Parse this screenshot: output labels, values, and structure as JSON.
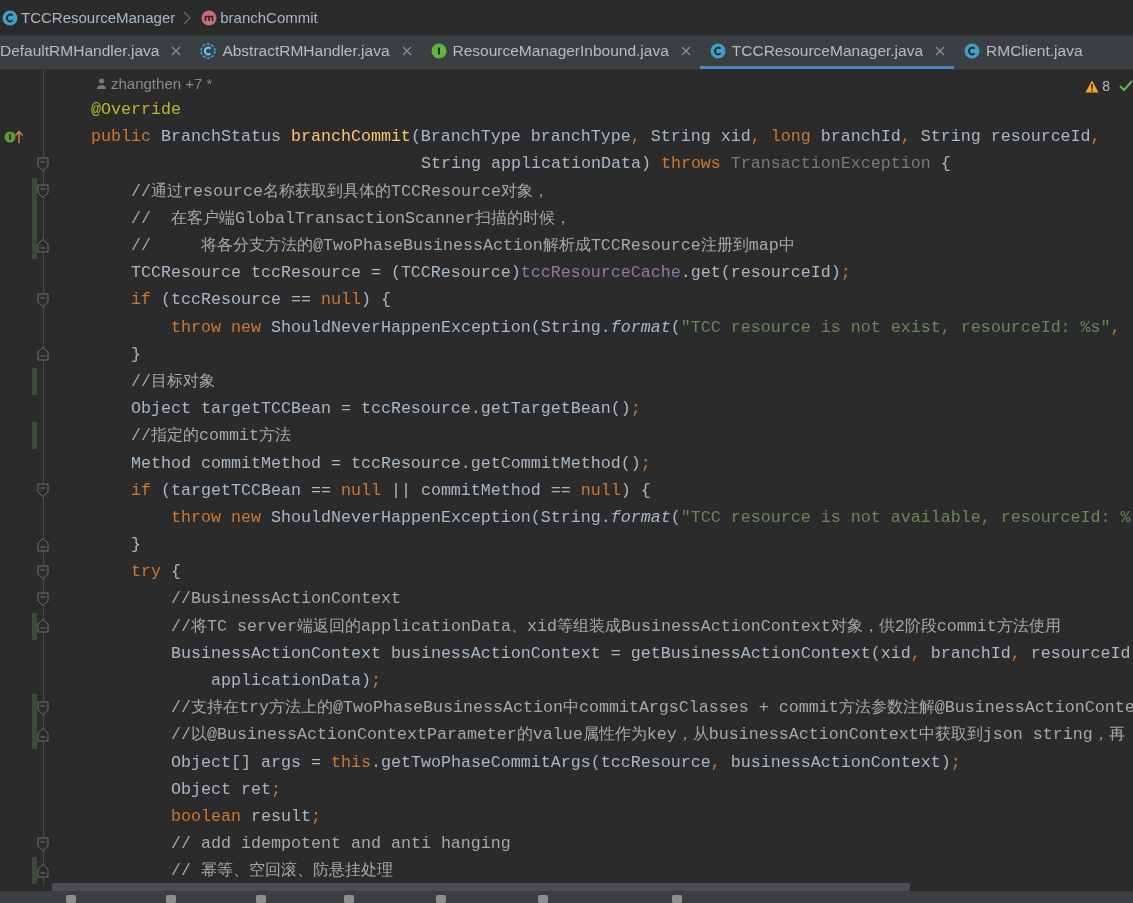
{
  "breadcrumb": [
    {
      "kind": "class",
      "text": "TCCResourceManager"
    },
    {
      "kind": "method",
      "text": "branchCommit"
    }
  ],
  "tabs": [
    {
      "label": "DefaultRMHandler.java",
      "kind": "plain",
      "selected": false
    },
    {
      "label": "AbstractRMHandler.java",
      "kind": "abstract",
      "selected": false
    },
    {
      "label": "ResourceManagerInbound.java",
      "kind": "interface",
      "selected": false
    },
    {
      "label": "TCCResourceManager.java",
      "kind": "class",
      "selected": true
    },
    {
      "label": "RMClient.java",
      "kind": "class",
      "selected": false
    }
  ],
  "editor": {
    "author_hint": "zhangthen +7 *",
    "warnings": "8",
    "lines": [
      {
        "kind": "code",
        "fold_start": false,
        "fold_end": false,
        "changed": false,
        "implemented": false,
        "tokens": [
          {
            "kind": "annotation",
            "text": "@Override"
          }
        ]
      },
      {
        "kind": "code",
        "fold_start": false,
        "fold_end": false,
        "changed": false,
        "implemented": true,
        "tokens": [
          {
            "kind": "keyword",
            "text": "public "
          },
          {
            "kind": "plain",
            "text": "BranchStatus "
          },
          {
            "kind": "declaration",
            "text": "branchCommit"
          },
          {
            "kind": "plain",
            "text": "(BranchType branchType"
          },
          {
            "kind": "keyword",
            "text": ", "
          },
          {
            "kind": "plain",
            "text": "String xid"
          },
          {
            "kind": "keyword",
            "text": ", long "
          },
          {
            "kind": "plain",
            "text": "branchId"
          },
          {
            "kind": "keyword",
            "text": ", "
          },
          {
            "kind": "plain",
            "text": "String resourceId"
          },
          {
            "kind": "keyword",
            "text": ","
          }
        ]
      },
      {
        "kind": "wrapped",
        "fold_start": true,
        "fold_end": false,
        "changed": false,
        "implemented": false,
        "tokens": [
          {
            "kind": "plain",
            "text": "String applicationData) "
          },
          {
            "kind": "keyword",
            "text": "throws "
          },
          {
            "kind": "unused",
            "text": "TransactionException"
          },
          {
            "kind": "plain",
            "text": " {"
          }
        ],
        "children": [
          {
            "kind": "code",
            "fold_start": true,
            "fold_end": false,
            "changed": true,
            "implemented": false,
            "tokens": [
              {
                "kind": "comment",
                "text": "//通过resource名称获取到具体的TCCResource对象，"
              }
            ]
          },
          {
            "kind": "code",
            "fold_start": false,
            "fold_end": false,
            "changed": true,
            "implemented": false,
            "tokens": [
              {
                "kind": "comment",
                "text": "//  在客户端GlobalTransactionScanner扫描的时候，"
              }
            ]
          },
          {
            "kind": "code",
            "fold_start": false,
            "fold_end": true,
            "changed": true,
            "implemented": false,
            "tokens": [
              {
                "kind": "comment",
                "text": "//     将各分支方法的@TwoPhaseBusinessAction解析成TCCResource注册到map中"
              }
            ]
          },
          {
            "kind": "code",
            "fold_start": false,
            "fold_end": false,
            "changed": false,
            "implemented": false,
            "tokens": [
              {
                "kind": "plain",
                "text": "TCCResource tccResource = (TCCResource)"
              },
              {
                "kind": "field",
                "text": "tccResourceCache"
              },
              {
                "kind": "plain",
                "text": ".get(resourceId)"
              },
              {
                "kind": "keyword",
                "text": ";"
              }
            ]
          },
          {
            "kind": "code",
            "fold_start": true,
            "fold_end": false,
            "changed": false,
            "implemented": false,
            "tokens": [
              {
                "kind": "keyword",
                "text": "if "
              },
              {
                "kind": "plain",
                "text": "(tccResource == "
              },
              {
                "kind": "keyword",
                "text": "null"
              },
              {
                "kind": "plain",
                "text": ") {"
              }
            ],
            "children": [
              {
                "kind": "code",
                "fold_start": false,
                "fold_end": false,
                "changed": false,
                "implemented": false,
                "tokens": [
                  {
                    "kind": "keyword",
                    "text": "throw new "
                  },
                  {
                    "kind": "plain",
                    "text": "ShouldNeverHappenException(String."
                  },
                  {
                    "kind": "static",
                    "text": "format"
                  },
                  {
                    "kind": "plain",
                    "text": "("
                  },
                  {
                    "kind": "string",
                    "text": "\"TCC resource is not exist, resourceId: %s\""
                  },
                  {
                    "kind": "keyword",
                    "text": ","
                  }
                ]
              }
            ]
          },
          {
            "kind": "code",
            "fold_start": false,
            "fold_end": true,
            "changed": false,
            "implemented": false,
            "tokens": [
              {
                "kind": "plain",
                "text": "}"
              }
            ]
          },
          {
            "kind": "code",
            "fold_start": false,
            "fold_end": false,
            "changed": true,
            "implemented": false,
            "tokens": [
              {
                "kind": "comment",
                "text": "//目标对象"
              }
            ]
          },
          {
            "kind": "code",
            "fold_start": false,
            "fold_end": false,
            "changed": false,
            "implemented": false,
            "tokens": [
              {
                "kind": "plain",
                "text": "Object targetTCCBean = tccResource.getTargetBean()"
              },
              {
                "kind": "keyword",
                "text": ";"
              }
            ]
          },
          {
            "kind": "code",
            "fold_start": false,
            "fold_end": false,
            "changed": true,
            "implemented": false,
            "tokens": [
              {
                "kind": "comment",
                "text": "//指定的commit方法"
              }
            ]
          },
          {
            "kind": "code",
            "fold_start": false,
            "fold_end": false,
            "changed": false,
            "implemented": false,
            "tokens": [
              {
                "kind": "plain",
                "text": "Method commitMethod = tccResource.getCommitMethod()"
              },
              {
                "kind": "keyword",
                "text": ";"
              }
            ]
          },
          {
            "kind": "code",
            "fold_start": true,
            "fold_end": false,
            "changed": false,
            "implemented": false,
            "tokens": [
              {
                "kind": "keyword",
                "text": "if "
              },
              {
                "kind": "plain",
                "text": "(targetTCCBean == "
              },
              {
                "kind": "keyword",
                "text": "null"
              },
              {
                "kind": "plain",
                "text": " || commitMethod == "
              },
              {
                "kind": "keyword",
                "text": "null"
              },
              {
                "kind": "plain",
                "text": ") {"
              }
            ],
            "children": [
              {
                "kind": "code",
                "fold_start": false,
                "fold_end": false,
                "changed": false,
                "implemented": false,
                "tokens": [
                  {
                    "kind": "keyword",
                    "text": "throw new "
                  },
                  {
                    "kind": "plain",
                    "text": "ShouldNeverHappenException(String."
                  },
                  {
                    "kind": "static",
                    "text": "format"
                  },
                  {
                    "kind": "plain",
                    "text": "("
                  },
                  {
                    "kind": "string",
                    "text": "\"TCC resource is not available, resourceId: %"
                  }
                ]
              }
            ]
          },
          {
            "kind": "code",
            "fold_start": false,
            "fold_end": true,
            "changed": false,
            "implemented": false,
            "tokens": [
              {
                "kind": "plain",
                "text": "}"
              }
            ]
          },
          {
            "kind": "code",
            "fold_start": true,
            "fold_end": false,
            "changed": false,
            "implemented": false,
            "tokens": [
              {
                "kind": "keyword",
                "text": "try "
              },
              {
                "kind": "plain",
                "text": "{"
              }
            ],
            "children": [
              {
                "kind": "code",
                "fold_start": true,
                "fold_end": false,
                "changed": false,
                "implemented": false,
                "tokens": [
                  {
                    "kind": "comment",
                    "text": "//BusinessActionContext"
                  }
                ]
              },
              {
                "kind": "code",
                "fold_start": false,
                "fold_end": true,
                "changed": true,
                "implemented": false,
                "tokens": [
                  {
                    "kind": "comment",
                    "text": "//将TC server端返回的applicationData、xid等组装成BusinessActionContext对象，供2阶段commit方法使用"
                  }
                ]
              },
              {
                "kind": "code",
                "fold_start": false,
                "fold_end": false,
                "changed": false,
                "implemented": false,
                "tokens": [
                  {
                    "kind": "plain",
                    "text": "BusinessActionContext businessActionContext = getBusinessActionContext(xid"
                  },
                  {
                    "kind": "keyword",
                    "text": ", "
                  },
                  {
                    "kind": "plain",
                    "text": "branchId"
                  },
                  {
                    "kind": "keyword",
                    "text": ", "
                  },
                  {
                    "kind": "plain",
                    "text": "resourceId"
                  }
                ],
                "children": [
                  {
                    "kind": "code",
                    "fold_start": false,
                    "fold_end": false,
                    "changed": false,
                    "implemented": false,
                    "tokens": [
                      {
                        "kind": "plain",
                        "text": "applicationData)"
                      },
                      {
                        "kind": "keyword",
                        "text": ";"
                      }
                    ]
                  }
                ]
              },
              {
                "kind": "code",
                "fold_start": true,
                "fold_end": false,
                "changed": true,
                "implemented": false,
                "tokens": [
                  {
                    "kind": "comment",
                    "text": "//支持在try方法上的@TwoPhaseBusinessAction中commitArgsClasses + commit方法参数注解@BusinessActionConte"
                  }
                ]
              },
              {
                "kind": "code",
                "fold_start": false,
                "fold_end": true,
                "changed": true,
                "implemented": false,
                "tokens": [
                  {
                    "kind": "comment",
                    "text": "//以@BusinessActionContextParameter的value属性作为key，从businessActionContext中获取到json string，再"
                  }
                ]
              },
              {
                "kind": "code",
                "fold_start": false,
                "fold_end": false,
                "changed": false,
                "implemented": false,
                "tokens": [
                  {
                    "kind": "plain",
                    "text": "Object[] args = "
                  },
                  {
                    "kind": "keyword",
                    "text": "this"
                  },
                  {
                    "kind": "plain",
                    "text": ".getTwoPhaseCommitArgs(tccResource"
                  },
                  {
                    "kind": "keyword",
                    "text": ", "
                  },
                  {
                    "kind": "plain",
                    "text": "businessActionContext)"
                  },
                  {
                    "kind": "keyword",
                    "text": ";"
                  }
                ]
              },
              {
                "kind": "code",
                "fold_start": false,
                "fold_end": false,
                "changed": false,
                "implemented": false,
                "tokens": [
                  {
                    "kind": "plain",
                    "text": "Object ret"
                  },
                  {
                    "kind": "keyword",
                    "text": ";"
                  }
                ]
              },
              {
                "kind": "code",
                "fold_start": false,
                "fold_end": false,
                "changed": false,
                "implemented": false,
                "tokens": [
                  {
                    "kind": "keyword",
                    "text": "boolean "
                  },
                  {
                    "kind": "plain",
                    "text": "result"
                  },
                  {
                    "kind": "keyword",
                    "text": ";"
                  }
                ]
              },
              {
                "kind": "code",
                "fold_start": true,
                "fold_end": false,
                "changed": false,
                "implemented": false,
                "tokens": [
                  {
                    "kind": "comment",
                    "text": "// add idempotent and anti hanging"
                  }
                ]
              },
              {
                "kind": "code",
                "fold_start": false,
                "fold_end": true,
                "changed": true,
                "implemented": false,
                "tokens": [
                  {
                    "kind": "comment",
                    "text": "// 幂等、空回滚、防悬挂处理"
                  }
                ]
              }
            ]
          }
        ]
      }
    ]
  }
}
